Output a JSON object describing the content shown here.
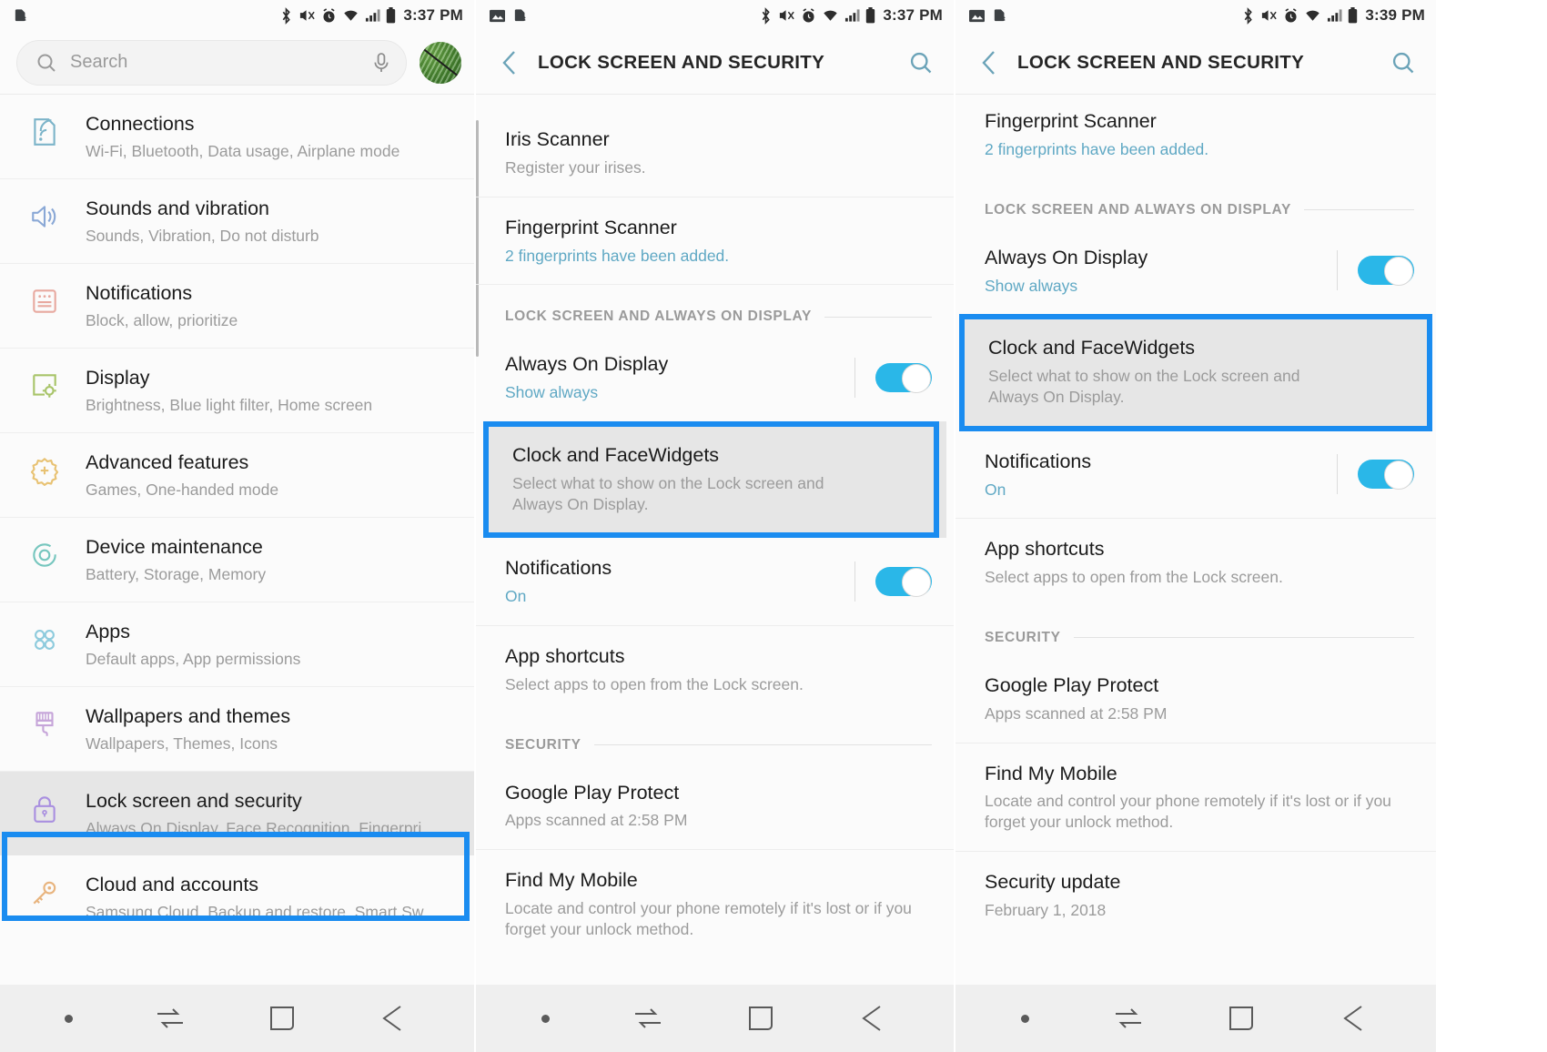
{
  "panels": [
    {
      "id": "settings-main",
      "statusbar": {
        "time": "3:37 PM",
        "left_icons": [
          "sim-card-off-icon"
        ],
        "right_icons": [
          "bluetooth-icon",
          "mute-vibrate-icon",
          "alarm-icon",
          "wifi-icon",
          "signal-icon",
          "battery-icon"
        ]
      },
      "search": {
        "placeholder": "Search",
        "mic_icon": "microphone-icon",
        "search_icon": "search-icon",
        "avatar": "user-avatar"
      },
      "items": [
        {
          "title": "Connections",
          "sub": "Wi-Fi, Bluetooth, Data usage, Airplane mode",
          "icon": "connections-icon",
          "color": "#7cb4c9",
          "selected": false
        },
        {
          "title": "Sounds and vibration",
          "sub": "Sounds, Vibration, Do not disturb",
          "icon": "speaker-icon",
          "color": "#8aa8d6",
          "selected": false
        },
        {
          "title": "Notifications",
          "sub": "Block, allow, prioritize",
          "icon": "notification-card-icon",
          "color": "#e8a9a0",
          "selected": false
        },
        {
          "title": "Display",
          "sub": "Brightness, Blue light filter, Home screen",
          "icon": "display-brightness-icon",
          "color": "#a8c469",
          "selected": false
        },
        {
          "title": "Advanced features",
          "sub": "Games, One-handed mode",
          "icon": "gear-plus-icon",
          "color": "#e8c273",
          "selected": false
        },
        {
          "title": "Device maintenance",
          "sub": "Battery, Storage, Memory",
          "icon": "refresh-circle-icon",
          "color": "#76c6be",
          "selected": false
        },
        {
          "title": "Apps",
          "sub": "Default apps, App permissions",
          "icon": "four-circles-icon",
          "color": "#8ecbdd",
          "selected": false
        },
        {
          "title": "Wallpapers and themes",
          "sub": "Wallpapers, Themes, Icons",
          "icon": "paintbrush-icon",
          "color": "#c6a5d9",
          "selected": false
        },
        {
          "title": "Lock screen and security",
          "sub": "Always On Display, Face Recognition, Fingerpri…",
          "icon": "padlock-icon",
          "color": "#a98fe0",
          "selected": true
        },
        {
          "title": "Cloud and accounts",
          "sub": "Samsung Cloud, Backup and restore, Smart Sw…",
          "icon": "key-icon",
          "color": "#e8b47e",
          "selected": false
        }
      ]
    },
    {
      "id": "lock-screen-security-a",
      "statusbar": {
        "time": "3:37 PM",
        "left_icons": [
          "image-icon",
          "sim-card-off-icon"
        ],
        "right_icons": [
          "bluetooth-icon",
          "mute-vibrate-icon",
          "alarm-icon",
          "wifi-icon",
          "signal-icon",
          "battery-icon"
        ]
      },
      "header": {
        "title": "LOCK SCREEN AND SECURITY",
        "back_icon": "back-chevron-icon",
        "search_icon": "search-icon"
      },
      "rows": [
        {
          "kind": "item",
          "title": "Iris Scanner",
          "sub": "Register your irises.",
          "sub_accent": false
        },
        {
          "kind": "item",
          "title": "Fingerprint Scanner",
          "sub": "2 fingerprints have been added.",
          "sub_accent": true
        },
        {
          "kind": "section",
          "label": "LOCK SCREEN AND ALWAYS ON DISPLAY"
        },
        {
          "kind": "toggle",
          "title": "Always On Display",
          "sub": "Show always",
          "sub_accent": true,
          "toggle_on": true
        },
        {
          "kind": "item",
          "title": "Clock and FaceWidgets",
          "sub": "Select what to show on the Lock screen and Always On Display.",
          "sub_accent": false,
          "highlighted": true
        },
        {
          "kind": "toggle",
          "title": "Notifications",
          "sub": "On",
          "sub_accent": true,
          "toggle_on": true
        },
        {
          "kind": "item",
          "title": "App shortcuts",
          "sub": "Select apps to open from the Lock screen.",
          "sub_accent": false
        },
        {
          "kind": "section",
          "label": "SECURITY"
        },
        {
          "kind": "item",
          "title": "Google Play Protect",
          "sub": "Apps scanned at 2:58 PM",
          "sub_accent": false
        },
        {
          "kind": "item",
          "title": "Find My Mobile",
          "sub": "Locate and control your phone remotely if it's lost or if you forget your unlock method.",
          "sub_accent": false
        }
      ]
    },
    {
      "id": "lock-screen-security-b",
      "statusbar": {
        "time": "3:39 PM",
        "left_icons": [
          "image-icon",
          "sim-card-off-icon"
        ],
        "right_icons": [
          "bluetooth-icon",
          "mute-vibrate-icon",
          "alarm-icon",
          "wifi-icon",
          "signal-icon",
          "battery-icon"
        ]
      },
      "header": {
        "title": "LOCK SCREEN AND SECURITY",
        "back_icon": "back-chevron-icon",
        "search_icon": "search-icon"
      },
      "rows": [
        {
          "kind": "item",
          "title": "Fingerprint Scanner",
          "sub": "2 fingerprints have been added.",
          "sub_accent": true
        },
        {
          "kind": "section",
          "label": "LOCK SCREEN AND ALWAYS ON DISPLAY"
        },
        {
          "kind": "toggle",
          "title": "Always On Display",
          "sub": "Show always",
          "sub_accent": true,
          "toggle_on": true
        },
        {
          "kind": "item",
          "title": "Clock and FaceWidgets",
          "sub": "Select what to show on the Lock screen and Always On Display.",
          "sub_accent": false,
          "highlighted": true
        },
        {
          "kind": "toggle",
          "title": "Notifications",
          "sub": "On",
          "sub_accent": true,
          "toggle_on": true
        },
        {
          "kind": "item",
          "title": "App shortcuts",
          "sub": "Select apps to open from the Lock screen.",
          "sub_accent": false
        },
        {
          "kind": "section",
          "label": "SECURITY"
        },
        {
          "kind": "item",
          "title": "Google Play Protect",
          "sub": "Apps scanned at 2:58 PM",
          "sub_accent": false
        },
        {
          "kind": "item",
          "title": "Find My Mobile",
          "sub": "Locate and control your phone remotely if it's lost or if you forget your unlock method.",
          "sub_accent": false
        },
        {
          "kind": "item",
          "title": "Security update",
          "sub": "February 1, 2018",
          "sub_accent": false
        }
      ]
    }
  ],
  "navbar": {
    "icons": [
      "dot-indicator",
      "recents-icon",
      "home-icon",
      "back-icon"
    ]
  },
  "colors": {
    "accent_blue": "#1a8cf0",
    "toggle_on": "#2ab7e8",
    "link_text": "#5fa8c4",
    "highlight_fill": "#e6e6e6"
  }
}
